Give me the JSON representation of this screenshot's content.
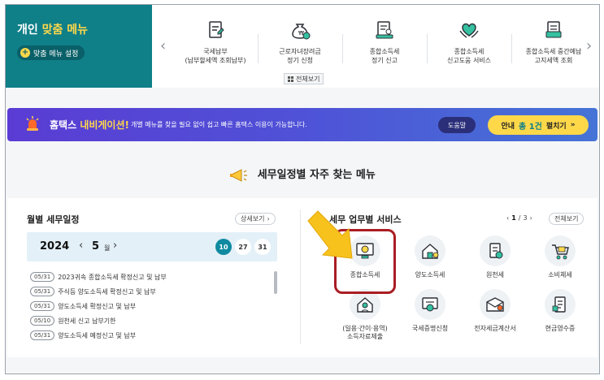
{
  "personal_menu": {
    "title_a": "개인",
    "title_b": "맞춤 메뉴",
    "settings_label": "맞춤 메뉴 설정"
  },
  "quick_menu": [
    {
      "icon": "document-edit-icon",
      "label": "국세납부\n(납부할세액 조회납부)"
    },
    {
      "icon": "money-bag-icon",
      "label": "근로자녀장려금\n정기 신청"
    },
    {
      "icon": "tax-filing-icon",
      "label": "종합소득세\n정기 신고"
    },
    {
      "icon": "heart-hands-icon",
      "label": "종합소득세\n신고도움 서비스"
    },
    {
      "icon": "document-list-icon",
      "label": "종합소득세 중간예납\n고지세액 조회"
    }
  ],
  "view_all_label": "전체보기",
  "nav_banner": {
    "title_a": "홈택스",
    "title_b": "내비게이션!",
    "description": "개별 메뉴를 찾을 필요 없이 쉽고 빠른 홈택스 이용이 가능합니다.",
    "help_label": "도움말",
    "notice_label": "안내",
    "notice_count": "총 1건",
    "expand_label": "펼치기"
  },
  "section_title": "세무일정별 자주 찾는 메뉴",
  "calendar": {
    "heading": "월별 세무일정",
    "detail_label": "상세보기",
    "year": "2024",
    "month": "5",
    "month_unit": "월",
    "days": [
      "10",
      "27",
      "31"
    ],
    "schedule": [
      {
        "date": "05/31",
        "text": "2023귀속 종합소득세 확정신고 및 납부"
      },
      {
        "date": "05/31",
        "text": "주식등 양도소득세 확정신고 및 납부"
      },
      {
        "date": "05/31",
        "text": "양도소득세 확정신고 및 납부"
      },
      {
        "date": "05/10",
        "text": "원천세 신고 납부기한"
      },
      {
        "date": "05/31",
        "text": "양도소득세 예정신고 및 납부"
      }
    ]
  },
  "services": {
    "heading": "세무 업무별 서비스",
    "page": "1",
    "total_pages": "3",
    "all_label": "전체보기",
    "items": [
      {
        "icon": "computer-tax-icon",
        "label": "종합소득세"
      },
      {
        "icon": "house-transfer-icon",
        "label": "양도소득세"
      },
      {
        "icon": "withholding-icon",
        "label": "원천세"
      },
      {
        "icon": "shopping-cart-icon",
        "label": "소비체세"
      },
      {
        "icon": "employment-report-icon",
        "label": "(일용·간이·용역)\n소득자료제출"
      },
      {
        "icon": "certificate-icon",
        "label": "국세증명신청"
      },
      {
        "icon": "e-invoice-icon",
        "label": "전자세금계산서"
      },
      {
        "icon": "cash-receipt-icon",
        "label": "현금영수증"
      }
    ]
  },
  "colors": {
    "teal": "#0f7f88",
    "yellow": "#ffd84a",
    "banner_purple": "#5a3cd4",
    "highlight_red": "#a91d23",
    "arrow_yellow": "#f7c21c"
  }
}
